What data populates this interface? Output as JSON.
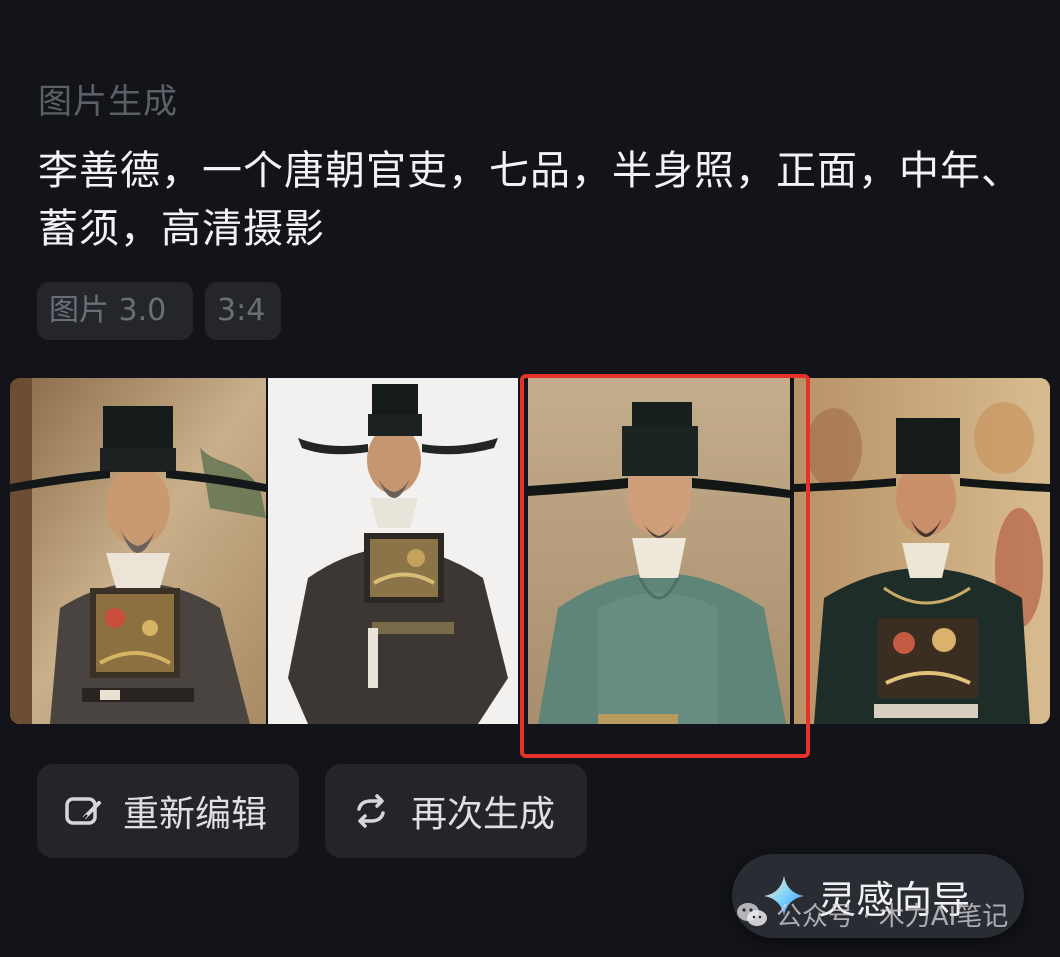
{
  "section": {
    "label": "图片生成"
  },
  "prompt": {
    "text": "李善德，一个唐朝官吏，七品，半身照，正面，中年、蓄须，高清摄影"
  },
  "tags": {
    "model": "图片 3.0",
    "ratio": "3:4"
  },
  "images": [
    {
      "icon": "portrait-image-1",
      "robe": "#4a4440",
      "background": "#c9b08a",
      "selected": false
    },
    {
      "icon": "portrait-image-2",
      "robe": "#3d3733",
      "background": "#f2f1ef",
      "selected": false
    },
    {
      "icon": "portrait-image-3",
      "robe": "#5f8478",
      "background": "#b99f7e",
      "selected": true
    },
    {
      "icon": "portrait-image-4",
      "robe": "#1f2d28",
      "background": "#c8a878",
      "selected": false
    }
  ],
  "actions": {
    "edit_label": "重新编辑",
    "edit_icon": "edit-icon",
    "regenerate_label": "再次生成",
    "regenerate_icon": "refresh-icon"
  },
  "inspiration": {
    "label": "灵感向导",
    "icon": "sparkle-icon"
  },
  "watermark": {
    "text": "公众号 · 木力AI笔记",
    "icon": "wechat-icon"
  },
  "colors": {
    "background": "#131419",
    "highlight": "#e6322a",
    "button": "#23252b"
  }
}
